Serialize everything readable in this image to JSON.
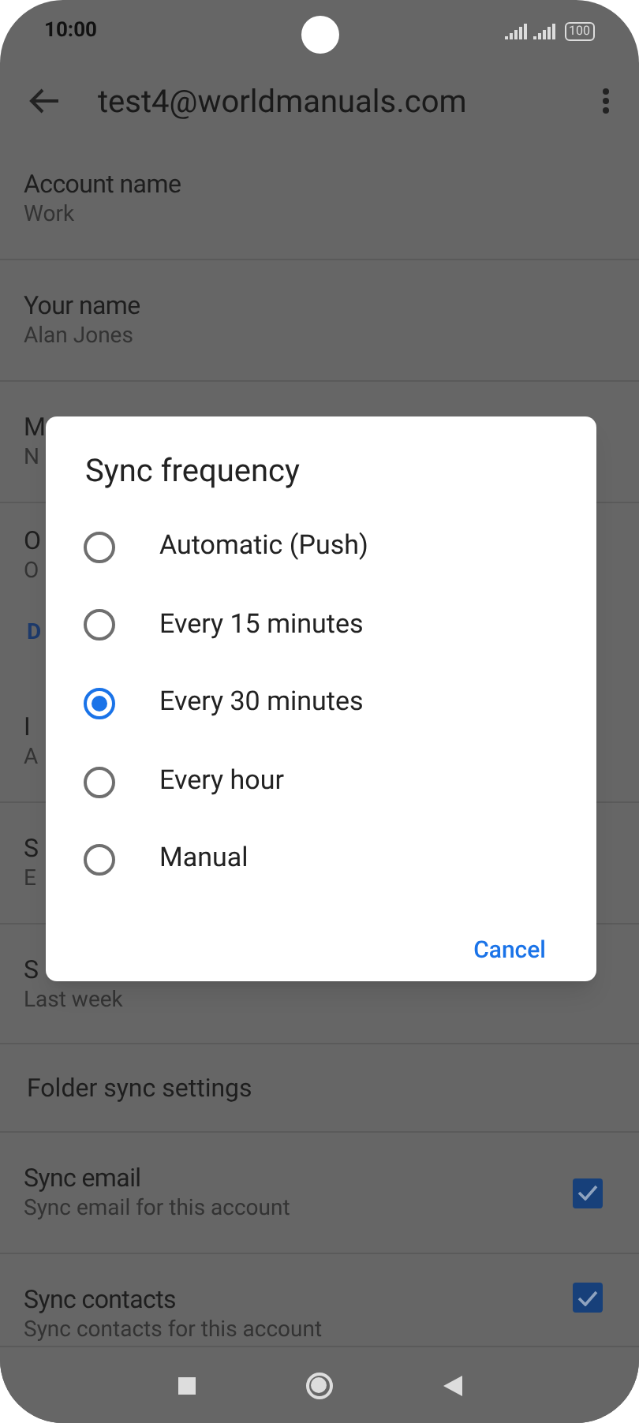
{
  "status_bar": {
    "time": "10:00",
    "battery": "100"
  },
  "app_bar": {
    "title": "test4@worldmanuals.com"
  },
  "settings": [
    {
      "kind": "item",
      "title": "Account name",
      "summary": "Work"
    },
    {
      "kind": "item",
      "title": "Your name",
      "summary": "Alan Jones"
    },
    {
      "kind": "item",
      "title": "M",
      "summary": "N"
    },
    {
      "kind": "item",
      "title": "O",
      "summary": "O"
    },
    {
      "kind": "header",
      "title": "D"
    },
    {
      "kind": "item",
      "title": "I",
      "summary": "A"
    },
    {
      "kind": "item",
      "title": "S",
      "summary": "E"
    },
    {
      "kind": "item",
      "title": "S",
      "summary": "Last week"
    },
    {
      "kind": "single",
      "title": "Folder sync settings"
    },
    {
      "kind": "check",
      "title": "Sync email",
      "summary": "Sync email for this account",
      "checked": true
    },
    {
      "kind": "check",
      "title": "Sync contacts",
      "summary": "Sync contacts for this account",
      "checked": true
    }
  ],
  "dialog": {
    "title": "Sync frequency",
    "options": [
      {
        "label": "Automatic (Push)",
        "selected": false
      },
      {
        "label": "Every 15 minutes",
        "selected": false
      },
      {
        "label": "Every 30 minutes",
        "selected": true
      },
      {
        "label": "Every hour",
        "selected": false
      },
      {
        "label": "Manual",
        "selected": false
      }
    ],
    "cancel": "Cancel"
  }
}
